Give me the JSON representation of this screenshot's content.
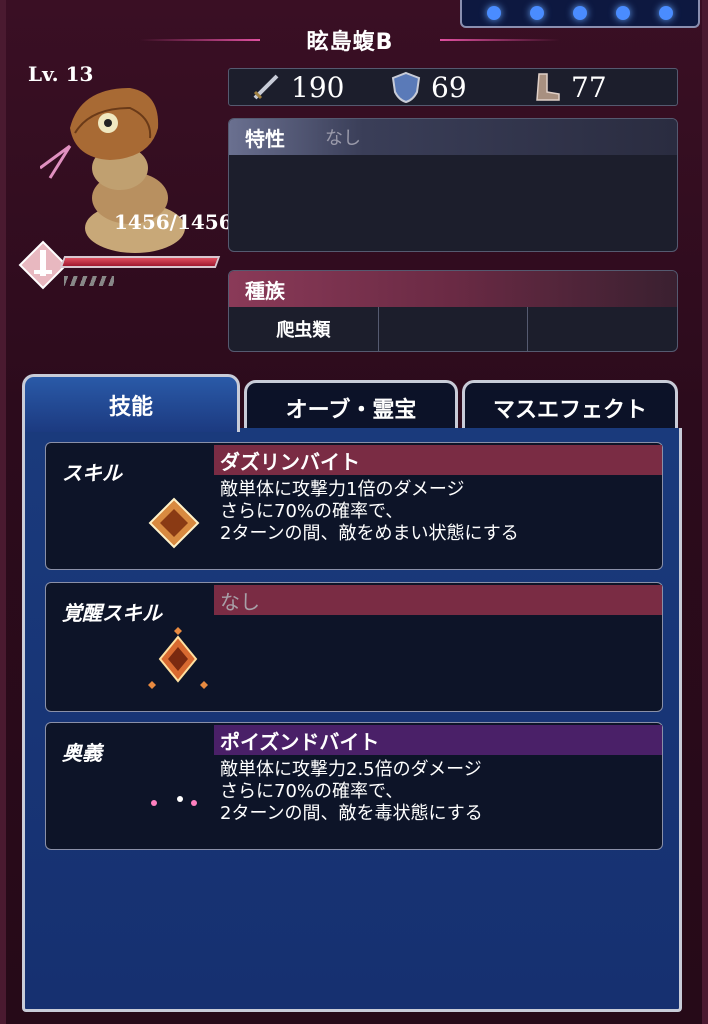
{
  "header": {
    "title": "眩島蝮B",
    "level": "Lv. 13",
    "hp": "1456/1456",
    "hp_fraction": 1.0
  },
  "stats": {
    "attack": "190",
    "defense": "69",
    "speed": "77"
  },
  "traits": {
    "label": "特性",
    "value": "なし"
  },
  "race": {
    "label": "種族",
    "cells": [
      "爬虫類",
      "",
      ""
    ]
  },
  "tabs": [
    {
      "label": "技能",
      "active": true
    },
    {
      "label": "オーブ・霊宝",
      "active": false
    },
    {
      "label": "マスエフェクト",
      "active": false
    }
  ],
  "skills": [
    {
      "kind": "スキル",
      "name": "ダズリンバイト",
      "icon": "amber-crystal-icon",
      "desc": "敵単体に攻撃力1倍のダメージ\nさらに70%の確率で、\n2ターンの間、敵をめまい状態にする"
    },
    {
      "kind": "覚醒スキル",
      "name": "なし",
      "icon": "awakened-crystal-icon",
      "desc": ""
    },
    {
      "kind": "奥義",
      "name": "ポイズンドバイト",
      "icon": "rainbow-moon-icon",
      "desc": "敵単体に攻撃力2.5倍のダメージ\nさらに70%の確率で、\n2ターンの間、敵を毒状態にする"
    }
  ],
  "colors": {
    "skill_bar": "#7a2c44",
    "ougi_bar": "#4a2068",
    "tab_active": "#2a5aa8"
  }
}
